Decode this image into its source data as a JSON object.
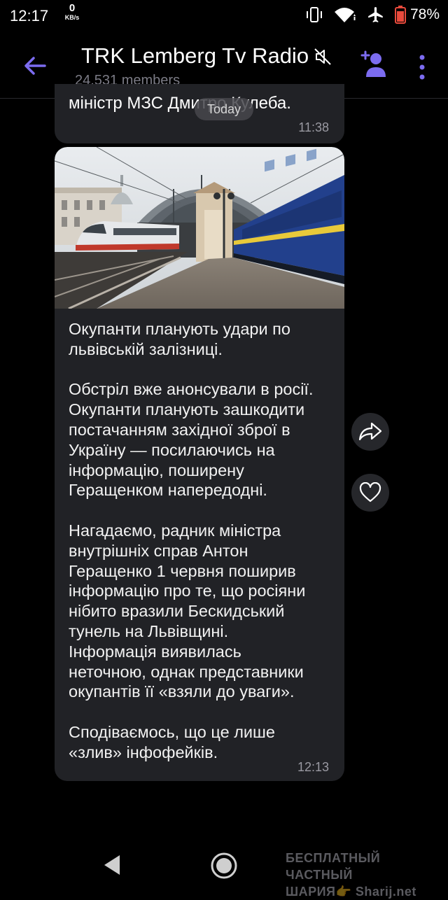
{
  "status_bar": {
    "time": "12:17",
    "net_speed_value": "0",
    "net_speed_unit": "KB/s",
    "battery_percent": "78%",
    "icons": [
      "vibrate-icon",
      "wifi-icon",
      "airplane-icon",
      "battery-icon"
    ]
  },
  "header": {
    "title": "TRK Lemberg Tv Radio",
    "subtitle": "24,531 members",
    "icons": [
      "back-arrow-icon",
      "muted-icon",
      "add-user-icon",
      "more-vert-icon"
    ]
  },
  "date_chip": "Today",
  "messages": [
    {
      "text": "міністр МЗС Дмитро Кулеба.",
      "time": "11:38"
    },
    {
      "has_photo": true,
      "text": "Окупанти планують удари по\nльвівській залізниці.\n\nОбстріл вже анонсували в росії.\nОкупанти планують зашкодити\nпостачанням західної зброї в\nУкраїну — посилаючись на\nінформацію, поширену\nГеращенком напередодні.\n\nНагадаємо, радник міністра\nвнутрішніх справ Антон\nГеращенко 1 червня поширив\nінформацію про те, що росіяни\nнібито вразили Бескидський\nтунель на Львівщині.\nІнформація виявилась\nнеточною, однак представники\nокупантів її «взяли до уваги».\n\nСподіваємось, що це лише\n«злив» інфофейків.",
      "time": "12:13"
    }
  ],
  "side_actions": [
    "share-icon",
    "heart-icon"
  ],
  "nav_bar": [
    "nav-back-icon",
    "nav-home-icon"
  ],
  "watermark": {
    "line1": "БЕСПЛАТНЫЙ ЧАСТНЫЙ",
    "line2": "ШАРИЯ👉 Sharij.net"
  },
  "colors": {
    "accent": "#7c6cf0",
    "bubble": "#212226",
    "background": "#000000"
  }
}
